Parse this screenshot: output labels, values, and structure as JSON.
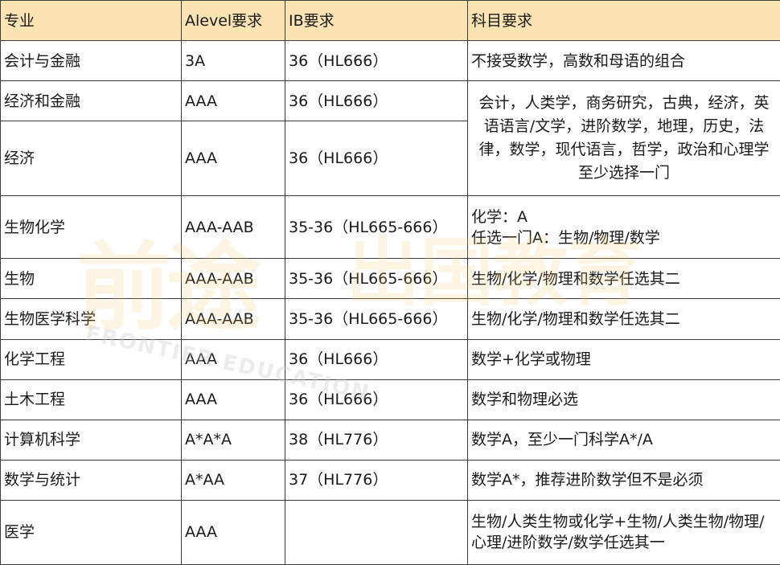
{
  "header": {
    "major": "专业",
    "alevel": "Alevel要求",
    "ib": "IB要求",
    "subjects": "科目要求"
  },
  "rows": [
    {
      "major": "会计与金融",
      "alevel": "3A",
      "ib": "36（HL666）",
      "subjects": "不接受数学，高数和母语的组合"
    },
    {
      "major": "经济和金融",
      "alevel": "AAA",
      "ib": "36（HL666）",
      "subjects": "会计，人类学，商务研究，古典，经济，英语语言/文学，进阶数学，地理，历史，法律，数学，现代语言，哲学，政治和心理学至少选择一门"
    },
    {
      "major": "经济",
      "alevel": "AAA",
      "ib": "36（HL666）",
      "subjects": ""
    },
    {
      "major": "生物化学",
      "alevel": "AAA-AAB",
      "ib": "35-36（HL665-666）",
      "subjects_line1": "化学：A",
      "subjects_line2": "任选一门A：生物/物理/数学"
    },
    {
      "major": "生物",
      "alevel": "AAA-AAB",
      "ib": "35-36（HL665-666）",
      "subjects": "生物/化学/物理和数学任选其二"
    },
    {
      "major": "生物医学科学",
      "alevel": "AAA-AAB",
      "ib": "35-36（HL665-666）",
      "subjects": "生物/化学/物理和数学任选其二"
    },
    {
      "major": "化学工程",
      "alevel": "AAA",
      "ib": "36（HL666）",
      "subjects": "数学+化学或物理"
    },
    {
      "major": "土木工程",
      "alevel": "AAA",
      "ib": "36（HL666）",
      "subjects": "数学和物理必选"
    },
    {
      "major": "计算机科学",
      "alevel": "A*A*A",
      "ib": "38（HL776）",
      "subjects": "数学A，至少一门科学A*/A"
    },
    {
      "major": "数学与统计",
      "alevel": "A*AA",
      "ib": "37（HL776）",
      "subjects": "数学A*，推荐进阶数学但不是必须"
    },
    {
      "major": "医学",
      "alevel": "AAA",
      "ib": "",
      "subjects": "生物/人类生物或化学+生物/人类生物/物理/心理/进阶数学/数学任选其一"
    }
  ],
  "watermark": {
    "left_text": "前途",
    "right_text": "出国教育",
    "sub_text": "FRONTIER EDUCATION"
  },
  "colors": {
    "header_bg": "#fbe3b2",
    "border": "#3c3c3c",
    "watermark": "#f6c560"
  }
}
